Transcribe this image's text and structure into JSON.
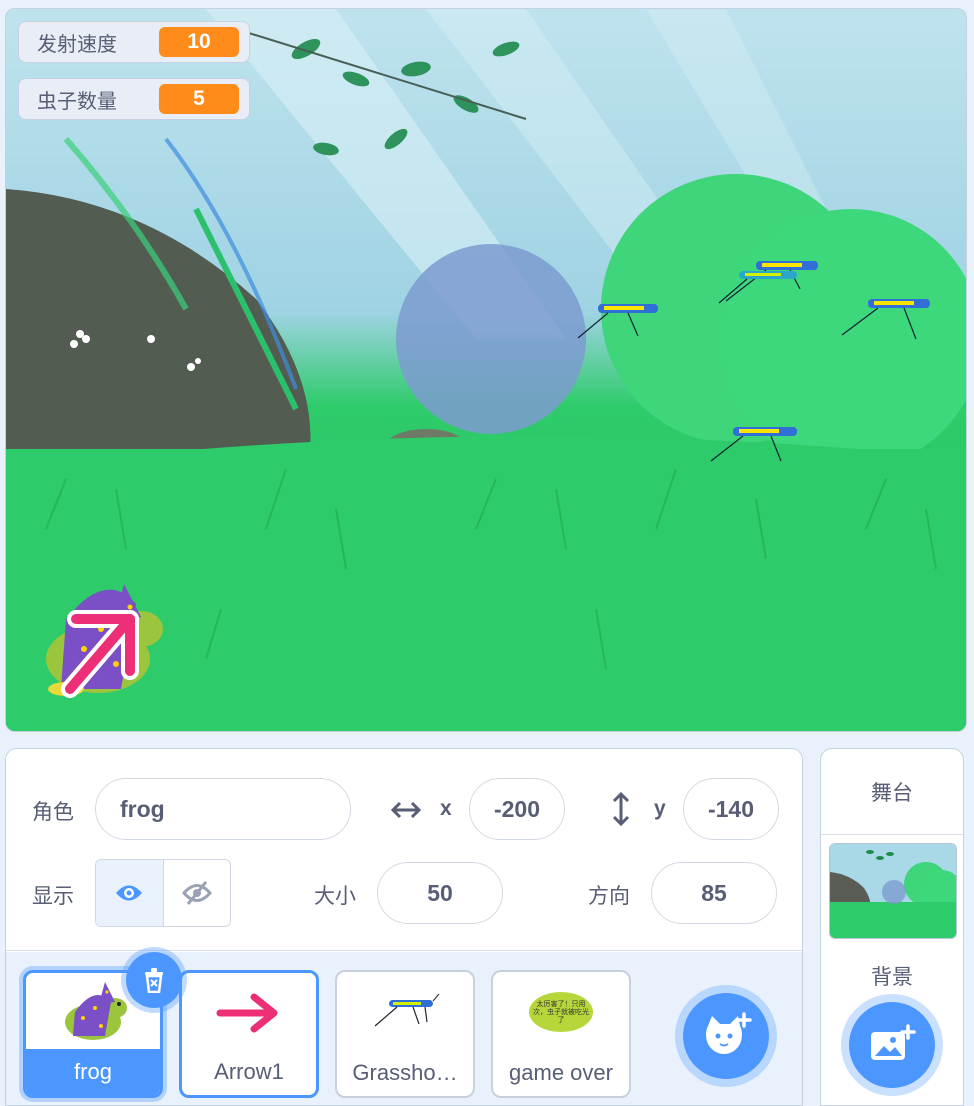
{
  "stage": {
    "monitors": [
      {
        "label": "发射速度",
        "value": "10"
      },
      {
        "label": "虫子数量",
        "value": "5"
      }
    ]
  },
  "sprite_info": {
    "sprite_label": "角色",
    "sprite_name": "frog",
    "x_label": "x",
    "x_value": "-200",
    "y_label": "y",
    "y_value": "-140",
    "show_label": "显示",
    "show_state": "visible",
    "size_label": "大小",
    "size_value": "50",
    "direction_label": "方向",
    "direction_value": "85"
  },
  "sprites": [
    {
      "name": "frog",
      "selected": true
    },
    {
      "name": "Arrow1",
      "selected": false
    },
    {
      "name": "Grassho…",
      "selected": false
    },
    {
      "name": "game over",
      "selected": false,
      "thumb_text": "太厉害了！只用  次，虫子就被吃光了"
    }
  ],
  "stage_pane": {
    "title": "舞台",
    "backdrop_label": "背景"
  },
  "colors": {
    "accent": "#4c97ff",
    "monitor_value": "#ff8c1a",
    "text": "#575e75",
    "arrow": "#ec2f76",
    "grass": "#2ecb6b"
  },
  "icons": [
    "delete-icon",
    "choose-sprite-icon",
    "choose-backdrop-icon",
    "eye-icon",
    "eye-slash-icon",
    "x-arrows-icon",
    "y-arrows-icon"
  ]
}
